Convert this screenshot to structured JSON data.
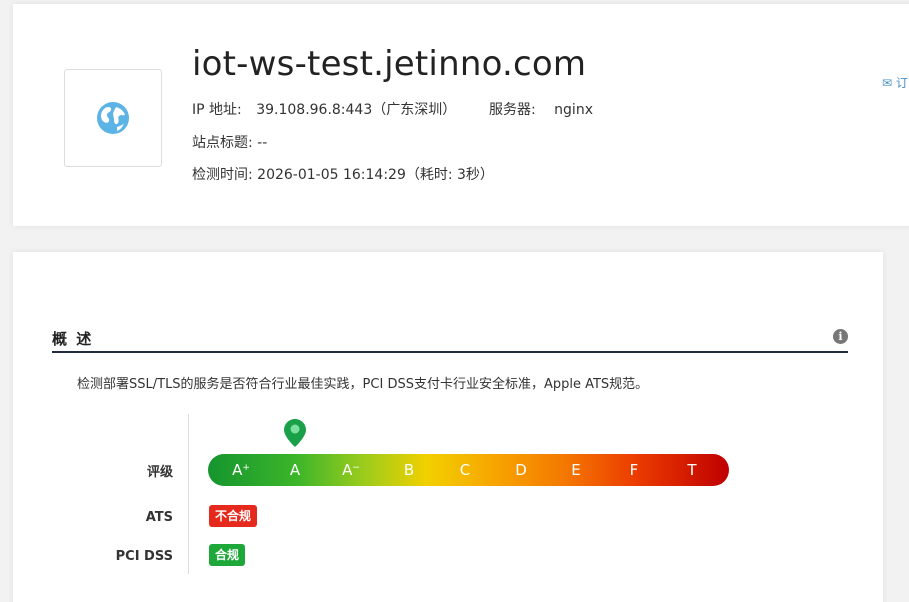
{
  "header": {
    "host": "iot-ws-test.jetinno.com",
    "ip_label": "IP 地址:",
    "ip_value": "39.108.96.8:443（广东深圳）",
    "server_label": "服务器:",
    "server_value": "nginx",
    "site_title_label": "站点标题:",
    "site_title_value": "--",
    "check_time_label": "检测时间:",
    "check_time_value": "2026-01-05 16:14:29（耗时: 3秒）",
    "mail_link": "订"
  },
  "overview": {
    "title": "概 述",
    "description": "检测部署SSL/TLS的服务是否符合行业最佳实践，PCI DSS支付卡行业安全标准，Apple ATS规范。",
    "grade_label": "评级",
    "grades": [
      "A+",
      "A",
      "A-",
      "B",
      "C",
      "D",
      "E",
      "F",
      "T"
    ],
    "selected_grade": "A",
    "ats_label": "ATS",
    "ats_value": "不合规",
    "pci_label": "PCI DSS",
    "pci_value": "合规"
  },
  "colors": {
    "non_compliant": "#e52a1d",
    "compliant": "#1fa83a",
    "pin": "#1aa048"
  }
}
